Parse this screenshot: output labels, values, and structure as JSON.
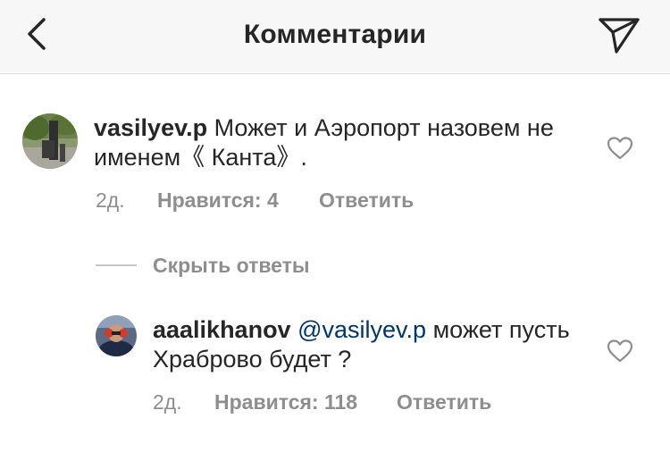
{
  "header": {
    "title": "Комментарии",
    "back_icon": "chevron-left-icon",
    "send_icon": "paper-plane-icon"
  },
  "comments": [
    {
      "username": "vasilyev.p",
      "text": "Может и Аэропорт назовем не именем《 Канта》.",
      "time": "2д.",
      "likes": "Нравится: 4",
      "reply": "Ответить"
    }
  ],
  "replies_toggle": "Скрыть ответы",
  "replies": [
    {
      "username": "aaalikhanov",
      "mention": "@vasilyev.p",
      "text": "может пусть Храброво будет ?",
      "time": "2д.",
      "likes": "Нравится: 118",
      "reply": "Ответить"
    }
  ],
  "colors": {
    "text": "#262626",
    "muted": "#8e8e8e",
    "mention": "#003569",
    "header_bg": "#f7f7f7"
  }
}
